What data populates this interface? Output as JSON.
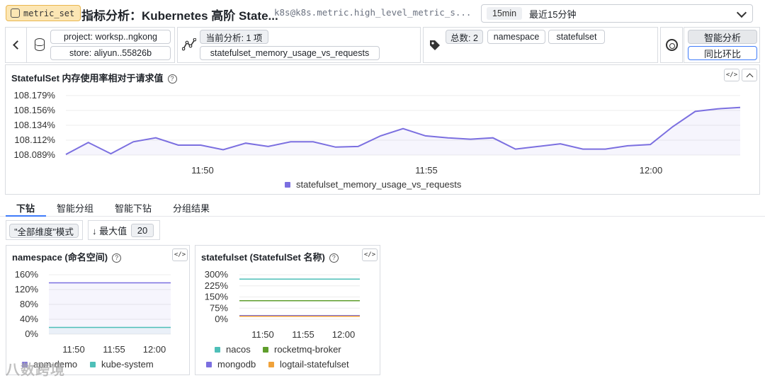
{
  "header": {
    "tag": "metric_set",
    "title": "指标分析：Kubernetes 高阶 State...",
    "metric_path": "k8s@k8s.metric.high_level_metric_s...",
    "time_short": "15min",
    "time_label": "最近15分钟"
  },
  "filters": {
    "project": "project: worksp..ngkong",
    "store": "store: aliyun..55826b",
    "current_analysis": "当前分析: 1 项",
    "metric": "statefulset_memory_usage_vs_requests",
    "total": "总数: 2",
    "tags": [
      "namespace",
      "statefulset"
    ],
    "analyze_button": "智能分析",
    "yoy_button": "同比环比"
  },
  "main_chart": {
    "title": "StatefulSet 内存使用率相对于请求值",
    "code_label": "</>",
    "color": "#7b6fe0"
  },
  "tabs": [
    "下钻",
    "智能分组",
    "智能下钻",
    "分组结果"
  ],
  "drill": {
    "mode_label": "\"全部维度\"模式",
    "max_label": "最大值",
    "max_value": "20"
  },
  "cards": [
    {
      "title": "namespace (命名空间)",
      "code_label": "</>"
    },
    {
      "title": "statefulset (StatefulSet 名称)",
      "code_label": "</>"
    }
  ],
  "watermark": "八数跨境",
  "chart_data": [
    {
      "type": "line",
      "title": "StatefulSet 内存使用率相对于请求值",
      "x_ticks": [
        "11:50",
        "11:55",
        "12:00"
      ],
      "y_ticks": [
        "108.179%",
        "108.156%",
        "108.134%",
        "108.112%",
        "108.089%"
      ],
      "ylim": [
        108.089,
        108.179
      ],
      "grid": true,
      "legend_position": "bottom",
      "series": [
        {
          "name": "statefulset_memory_usage_vs_requests",
          "color": "#7b6fe0",
          "x": [
            "11:47",
            "11:47:30",
            "11:48",
            "11:48:30",
            "11:49",
            "11:49:30",
            "11:50",
            "11:50:30",
            "11:51",
            "11:51:30",
            "11:52",
            "11:52:30",
            "11:53",
            "11:53:30",
            "11:54",
            "11:54:30",
            "11:55",
            "11:55:30",
            "11:56",
            "11:56:30",
            "11:57",
            "11:57:30",
            "11:58",
            "11:58:30",
            "11:59",
            "11:59:30",
            "12:00",
            "12:00:30",
            "12:01",
            "12:01:30",
            "12:02"
          ],
          "values": [
            108.09,
            108.108,
            108.091,
            108.109,
            108.115,
            108.104,
            108.104,
            108.097,
            108.107,
            108.102,
            108.109,
            108.109,
            108.101,
            108.102,
            108.118,
            108.129,
            108.118,
            108.115,
            108.113,
            108.115,
            108.098,
            108.102,
            108.106,
            108.098,
            108.098,
            108.103,
            108.105,
            108.132,
            108.155,
            108.159,
            108.161
          ]
        }
      ]
    },
    {
      "type": "line",
      "title": "namespace (命名空间)",
      "x_ticks": [
        "11:50",
        "11:55",
        "12:00"
      ],
      "y_ticks": [
        "160%",
        "120%",
        "80%",
        "40%",
        "0%"
      ],
      "ylim": [
        0,
        160
      ],
      "grid": true,
      "legend_position": "bottom",
      "series": [
        {
          "name": "apm-demo",
          "color": "#7b6fe0",
          "values": [
            138,
            138
          ]
        },
        {
          "name": "kube-system",
          "color": "#4ebfb8",
          "values": [
            18,
            18
          ]
        }
      ]
    },
    {
      "type": "line",
      "title": "statefulset (StatefulSet 名称)",
      "x_ticks": [
        "11:50",
        "11:55",
        "12:00"
      ],
      "y_ticks": [
        "300%",
        "225%",
        "150%",
        "75%",
        "0%"
      ],
      "ylim": [
        0,
        300
      ],
      "grid": true,
      "legend_position": "bottom",
      "series": [
        {
          "name": "nacos",
          "color": "#4ebfb8",
          "values": [
            270,
            270
          ]
        },
        {
          "name": "rocketmq-broker",
          "color": "#5f9e2c",
          "values": [
            125,
            125
          ]
        },
        {
          "name": "mongodb",
          "color": "#7b6fe0",
          "values": [
            25,
            25
          ]
        },
        {
          "name": "logtail-statefulset",
          "color": "#f0a23a",
          "values": [
            20,
            20
          ]
        }
      ]
    }
  ]
}
